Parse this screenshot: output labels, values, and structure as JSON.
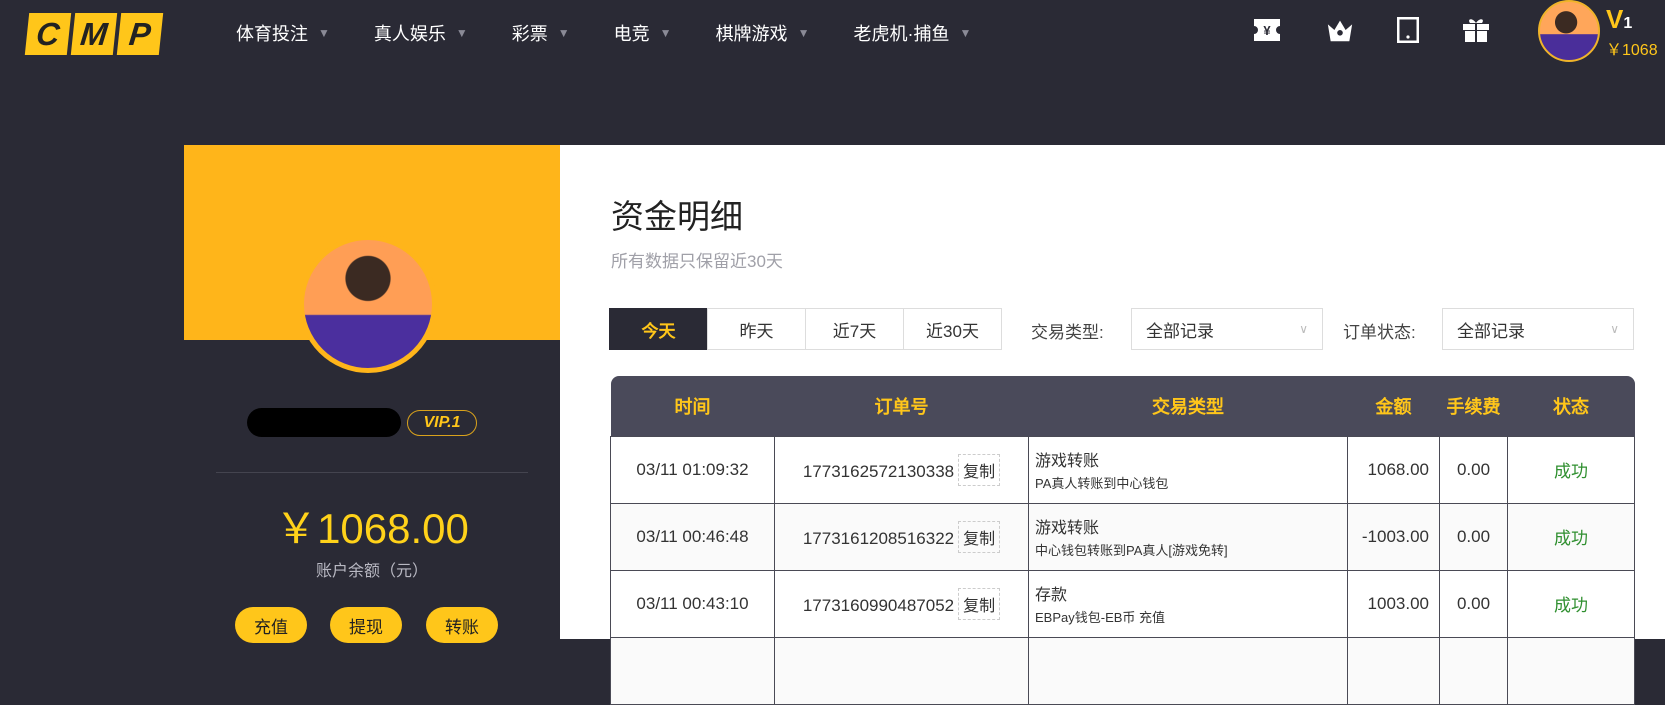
{
  "header": {
    "logo": [
      "C",
      "M",
      "P"
    ],
    "nav": [
      {
        "label": "体育投注"
      },
      {
        "label": "真人娱乐"
      },
      {
        "label": "彩票"
      },
      {
        "label": "电竞"
      },
      {
        "label": "棋牌游戏"
      },
      {
        "label": "老虎机·捕鱼"
      }
    ],
    "icons": [
      "ticket-yen-icon",
      "crown-icon",
      "tablet-icon",
      "gift-icon"
    ],
    "user": {
      "level": "V",
      "level_num": "1",
      "balance": "￥1068"
    }
  },
  "profile": {
    "vip": "VIP.1",
    "balance": "￥1068.00",
    "balance_label": "账户余额（元）",
    "buttons": [
      "充值",
      "提现",
      "转账"
    ],
    "watermark": "CMP"
  },
  "main": {
    "title": "资金明细",
    "subtitle": "所有数据只保留近30天",
    "tabs": [
      "今天",
      "昨天",
      "近7天",
      "近30天"
    ],
    "active_tab": "今天",
    "filters": [
      {
        "label": "交易类型:",
        "value": "全部记录"
      },
      {
        "label": "订单状态:",
        "value": "全部记录"
      }
    ],
    "table": {
      "columns": [
        "时间",
        "订单号",
        "交易类型",
        "金额",
        "手续费",
        "状态"
      ],
      "copy_label": "复制",
      "rows": [
        {
          "time": "03/11 01:09:32",
          "order": "1773162572130338",
          "type": "游戏转账",
          "detail": "PA真人转账到中心钱包",
          "amount": "1068.00",
          "fee": "0.00",
          "status": "成功"
        },
        {
          "time": "03/11 00:46:48",
          "order": "1773161208516322",
          "type": "游戏转账",
          "detail": "中心钱包转账到PA真人[游戏免转]",
          "amount": "-1003.00",
          "fee": "0.00",
          "status": "成功"
        },
        {
          "time": "03/11 00:43:10",
          "order": "1773160990487052",
          "type": "存款",
          "detail": "EBPay钱包-EB币 充值",
          "amount": "1003.00",
          "fee": "0.00",
          "status": "成功"
        }
      ]
    }
  },
  "colors": {
    "accent": "#ffc61a",
    "dark": "#2a2a35",
    "success": "#2f8f2f"
  }
}
